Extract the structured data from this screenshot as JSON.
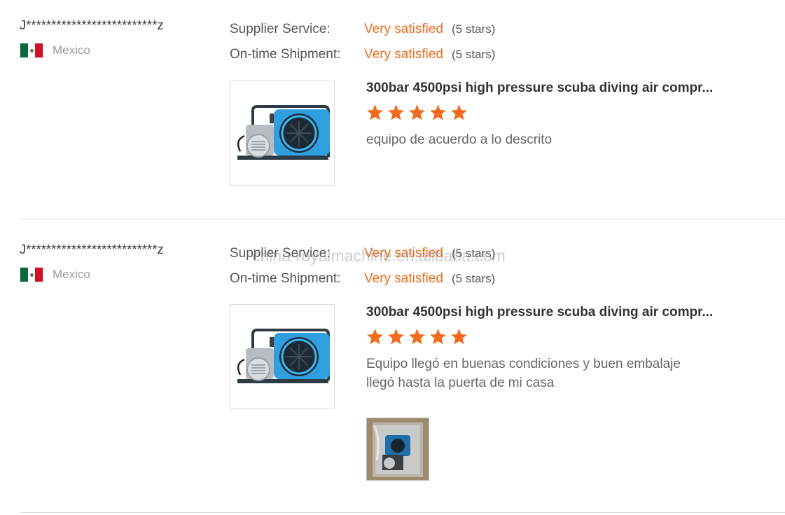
{
  "reviews": [
    {
      "username": "J**************************z",
      "country": "Mexico",
      "ratings": [
        {
          "label": "Supplier Service:",
          "value": "Very satisfied",
          "stars": "(5 stars)"
        },
        {
          "label": "On-time Shipment:",
          "value": "Very satisfied",
          "stars": "(5 stars)"
        }
      ],
      "product_title": "300bar 4500psi high pressure scuba diving air compr...",
      "star_rating": 5,
      "comment_lines": [
        "equipo de acuerdo a lo descrito"
      ]
    },
    {
      "username": "J**************************z",
      "country": "Mexico",
      "ratings": [
        {
          "label": "Supplier Service:",
          "value": "Very satisfied",
          "stars": "(5 stars)"
        },
        {
          "label": "On-time Shipment:",
          "value": "Very satisfied",
          "stars": "(5 stars)"
        }
      ],
      "product_title": "300bar 4500psi high pressure scuba diving air compr...",
      "star_rating": 5,
      "comment_lines": [
        "Equipo llegó en buenas condiciones y buen embalaje",
        "llegó hasta la puerta de mi casa"
      ]
    }
  ],
  "watermark": "china-royalmachine.en.alibaba.com",
  "colors": {
    "accent": "#f26b1d",
    "star": "#f26b1d",
    "divider": "#d9d9d9"
  },
  "icons": {
    "flag": "mexico-flag-icon",
    "star": "star-icon",
    "product": "air-compressor-image"
  }
}
